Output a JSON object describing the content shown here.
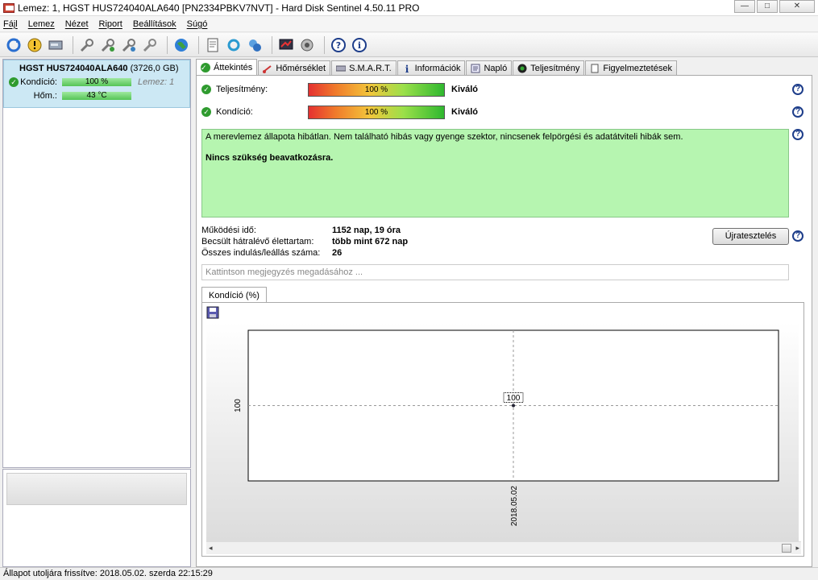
{
  "window": {
    "title": "Lemez: 1, HGST HUS724040ALA640 [PN2334PBKV7NVT]  -  Hard Disk Sentinel 4.50.11 PRO",
    "minimize": "—",
    "maximize": "□",
    "close": "✕"
  },
  "menu": [
    "Fájl",
    "Lemez",
    "Nézet",
    "Riport",
    "Beállítások",
    "Súgó"
  ],
  "disk": {
    "name": "HGST HUS724040ALA640",
    "capacity": "(3726,0 GB)",
    "condition_label": "Kondíció:",
    "condition_value": "100 %",
    "disk_index": "Lemez: 1",
    "temp_label": "Hőm.:",
    "temp_value": "43 °C"
  },
  "tabs": [
    "Áttekintés",
    "Hőmérséklet",
    "S.M.A.R.T.",
    "Információk",
    "Napló",
    "Teljesítmény",
    "Figyelmeztetések"
  ],
  "overview": {
    "performance_label": "Teljesítmény:",
    "performance_value": "100 %",
    "performance_status": "Kiváló",
    "condition_label": "Kondíció:",
    "condition_value": "100 %",
    "condition_status": "Kiváló",
    "message_line1": "A merevlemez állapota hibátlan. Nem található hibás vagy gyenge szektor, nincsenek felpörgési és adatátviteli hibák sem.",
    "message_line2": "Nincs szükség beavatkozásra.",
    "uptime_label": "Működési idő:",
    "uptime_value": "1152 nap, 19 óra",
    "remaining_label": "Becsült hátralévő élettartam:",
    "remaining_value": "több mint 672 nap",
    "startstop_label": "Összes indulás/leállás száma:",
    "startstop_value": "26",
    "retest_button": "Újratesztelés",
    "note_placeholder": "Kattintson megjegyzés megadásához ...",
    "help": "?"
  },
  "graph_tab": "Kondíció  (%)",
  "chart_data": {
    "type": "line",
    "x": [
      "2018.05.02"
    ],
    "series": [
      {
        "values": [
          100
        ]
      }
    ],
    "y_tick_labels": [
      "100"
    ],
    "data_labels": [
      "100"
    ],
    "grid": true
  },
  "statusbar": "Állapot utoljára frissítve: 2018.05.02. szerda 22:15:29"
}
